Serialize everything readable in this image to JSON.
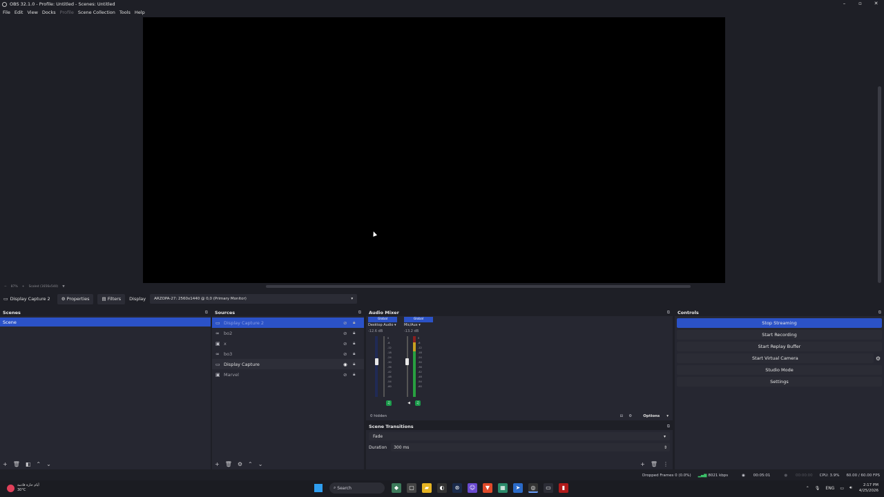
{
  "window": {
    "title": "OBS 32.1.0 - Profile: Untitled - Scenes: Untitled"
  },
  "menu": [
    "File",
    "Edit",
    "View",
    "Docks",
    "Profile",
    "Scene Collection",
    "Tools",
    "Help"
  ],
  "zoom": {
    "minus": "−",
    "value": "87%",
    "plus": "+",
    "mode": "Scaled (1656x540)"
  },
  "context_bar": {
    "source_name": "Display Capture 2",
    "properties_label": "Properties",
    "filters_label": "Filters",
    "display_label": "Display",
    "display_value": "ARZOPA-27: 2560x1440 @ 0,0 (Primary Monitor)"
  },
  "scenes": {
    "title": "Scenes",
    "items": [
      "Scene"
    ]
  },
  "sources": {
    "title": "Sources",
    "items": [
      {
        "name": "Display Capture 2",
        "icon": "monitor-icon",
        "selected": true
      },
      {
        "name": "bo2",
        "icon": "link-icon"
      },
      {
        "name": "x",
        "icon": "window-icon"
      },
      {
        "name": "bo3",
        "icon": "link-icon"
      },
      {
        "name": "Display Capture",
        "icon": "monitor-icon",
        "hovered": true
      },
      {
        "name": "Marvel",
        "icon": "window-icon"
      }
    ]
  },
  "mixer": {
    "title": "Audio Mixer",
    "channels": [
      {
        "global": "Global",
        "name": "Desktop Audio",
        "db": "-12.6 dB"
      },
      {
        "global": "Global",
        "name": "Mic/Aux",
        "db": "-13.2 dB"
      }
    ],
    "scale": [
      "0",
      "-6",
      "-12",
      "-18",
      "-24",
      "-30",
      "-36",
      "-42",
      "-48",
      "-54",
      "-60"
    ],
    "hidden": "0 hidden",
    "options": "Options"
  },
  "transitions": {
    "title": "Scene Transitions",
    "selected": "Fade",
    "duration_label": "Duration",
    "duration_value": "300 ms"
  },
  "controls": {
    "title": "Controls",
    "stop_streaming": "Stop Streaming",
    "start_recording": "Start Recording",
    "start_replay": "Start Replay Buffer",
    "start_vcam": "Start Virtual Camera",
    "studio_mode": "Studio Mode",
    "settings": "Settings"
  },
  "status": {
    "dropped": "Dropped Frames 0 (0.0%)",
    "bitrate": "8021 kbps",
    "stream_time": "00:05:01",
    "rec_time": "00:00:00",
    "cpu": "CPU: 3.9%",
    "fps": "60.00 / 60.00 FPS"
  },
  "taskbar": {
    "weather_line1": "أيام حارة قادمة",
    "weather_line2": "30°C",
    "search": "Search",
    "lang": "ENG",
    "time": "2:17 PM",
    "date": "4/25/2026"
  },
  "colors": {
    "accent": "#2b52c7",
    "panel": "#262731",
    "background": "#1e1f26"
  }
}
